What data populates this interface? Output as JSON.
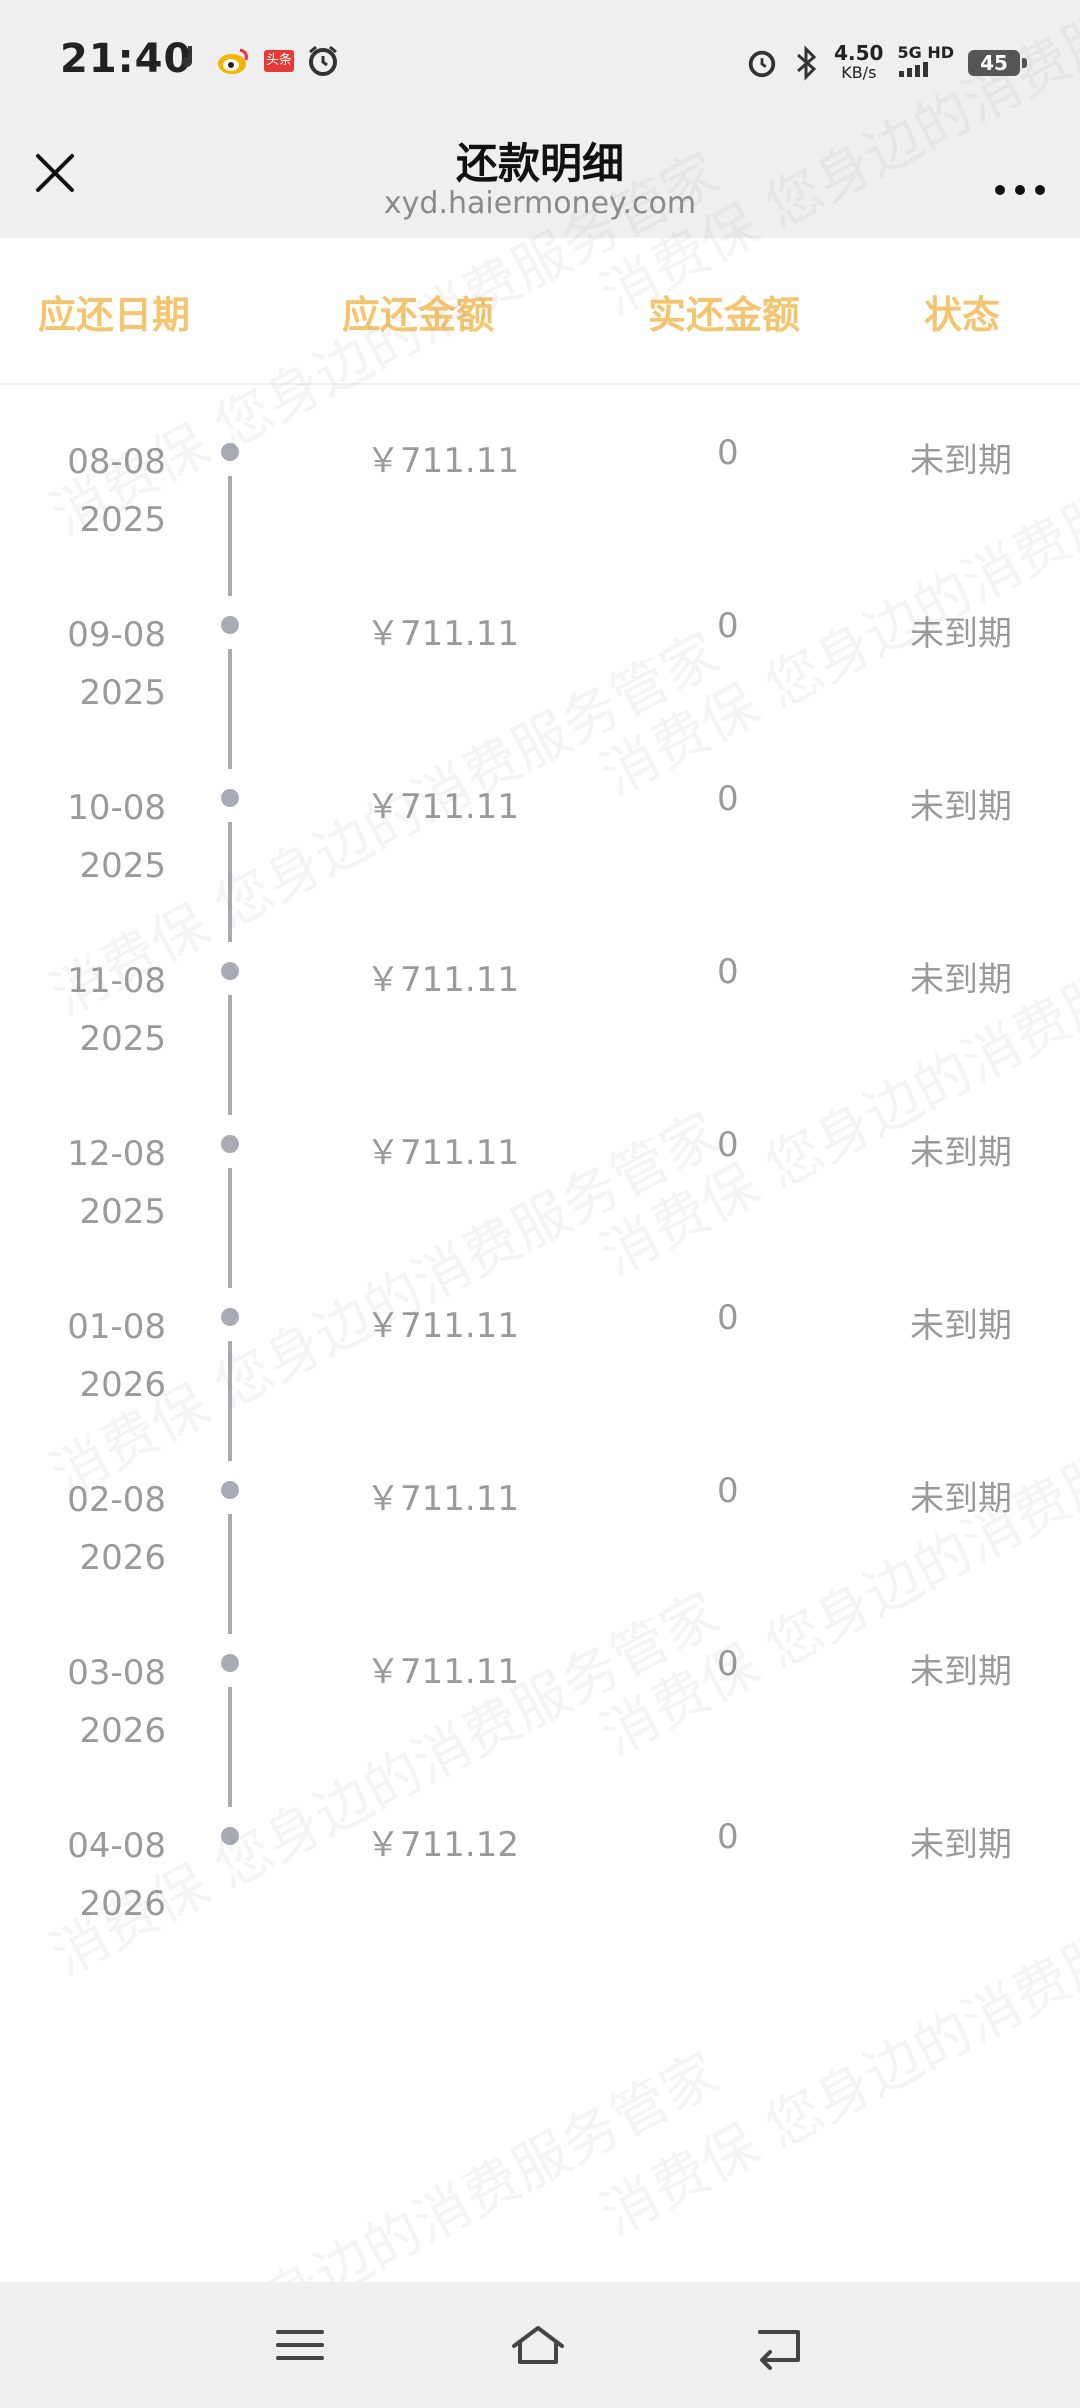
{
  "status_bar": {
    "time": "21:40",
    "left_icons": [
      "music-note-icon",
      "weibo-icon",
      "toutiao-icon",
      "alarm-icon"
    ],
    "toutiao_label": "头条",
    "net_speed_value": "4.50",
    "net_speed_unit": "KB/s",
    "network_label": "5G HD",
    "battery_level": "45"
  },
  "nav": {
    "title": "还款明细",
    "subtitle": "xyd.haiermoney.com"
  },
  "table": {
    "headers": [
      "应还日期",
      "应还金额",
      "实还金额",
      "状态"
    ],
    "rows": [
      {
        "date_md": "08-08",
        "year": "2025",
        "amount": "￥711.11",
        "paid": "0",
        "status": "未到期"
      },
      {
        "date_md": "09-08",
        "year": "2025",
        "amount": "￥711.11",
        "paid": "0",
        "status": "未到期"
      },
      {
        "date_md": "10-08",
        "year": "2025",
        "amount": "￥711.11",
        "paid": "0",
        "status": "未到期"
      },
      {
        "date_md": "11-08",
        "year": "2025",
        "amount": "￥711.11",
        "paid": "0",
        "status": "未到期"
      },
      {
        "date_md": "12-08",
        "year": "2025",
        "amount": "￥711.11",
        "paid": "0",
        "status": "未到期"
      },
      {
        "date_md": "01-08",
        "year": "2026",
        "amount": "￥711.11",
        "paid": "0",
        "status": "未到期"
      },
      {
        "date_md": "02-08",
        "year": "2026",
        "amount": "￥711.11",
        "paid": "0",
        "status": "未到期"
      },
      {
        "date_md": "03-08",
        "year": "2026",
        "amount": "￥711.11",
        "paid": "0",
        "status": "未到期"
      },
      {
        "date_md": "04-08",
        "year": "2026",
        "amount": "￥711.12",
        "paid": "0",
        "status": "未到期"
      }
    ]
  },
  "watermark_text": "消费保 您身边的消费服务管家",
  "colors": {
    "header_accent": "#f5c46f",
    "timeline": "#a8aab6",
    "bar_bg": "#efefef"
  },
  "bottom_nav": [
    "menu-icon",
    "home-icon",
    "back-icon"
  ]
}
